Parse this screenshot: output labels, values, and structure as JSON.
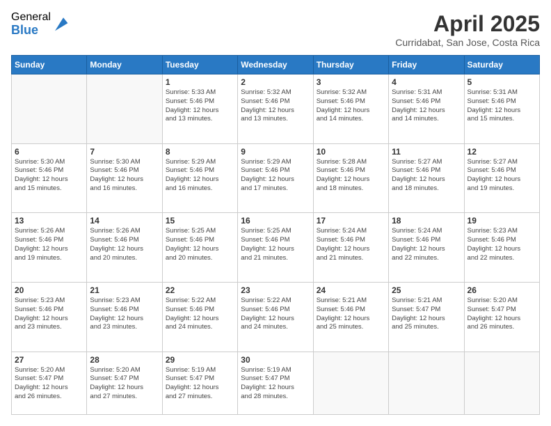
{
  "logo": {
    "general": "General",
    "blue": "Blue"
  },
  "header": {
    "title": "April 2025",
    "subtitle": "Curridabat, San Jose, Costa Rica"
  },
  "weekdays": [
    "Sunday",
    "Monday",
    "Tuesday",
    "Wednesday",
    "Thursday",
    "Friday",
    "Saturday"
  ],
  "weeks": [
    [
      {
        "day": "",
        "detail": ""
      },
      {
        "day": "",
        "detail": ""
      },
      {
        "day": "1",
        "detail": "Sunrise: 5:33 AM\nSunset: 5:46 PM\nDaylight: 12 hours\nand 13 minutes."
      },
      {
        "day": "2",
        "detail": "Sunrise: 5:32 AM\nSunset: 5:46 PM\nDaylight: 12 hours\nand 13 minutes."
      },
      {
        "day": "3",
        "detail": "Sunrise: 5:32 AM\nSunset: 5:46 PM\nDaylight: 12 hours\nand 14 minutes."
      },
      {
        "day": "4",
        "detail": "Sunrise: 5:31 AM\nSunset: 5:46 PM\nDaylight: 12 hours\nand 14 minutes."
      },
      {
        "day": "5",
        "detail": "Sunrise: 5:31 AM\nSunset: 5:46 PM\nDaylight: 12 hours\nand 15 minutes."
      }
    ],
    [
      {
        "day": "6",
        "detail": "Sunrise: 5:30 AM\nSunset: 5:46 PM\nDaylight: 12 hours\nand 15 minutes."
      },
      {
        "day": "7",
        "detail": "Sunrise: 5:30 AM\nSunset: 5:46 PM\nDaylight: 12 hours\nand 16 minutes."
      },
      {
        "day": "8",
        "detail": "Sunrise: 5:29 AM\nSunset: 5:46 PM\nDaylight: 12 hours\nand 16 minutes."
      },
      {
        "day": "9",
        "detail": "Sunrise: 5:29 AM\nSunset: 5:46 PM\nDaylight: 12 hours\nand 17 minutes."
      },
      {
        "day": "10",
        "detail": "Sunrise: 5:28 AM\nSunset: 5:46 PM\nDaylight: 12 hours\nand 18 minutes."
      },
      {
        "day": "11",
        "detail": "Sunrise: 5:27 AM\nSunset: 5:46 PM\nDaylight: 12 hours\nand 18 minutes."
      },
      {
        "day": "12",
        "detail": "Sunrise: 5:27 AM\nSunset: 5:46 PM\nDaylight: 12 hours\nand 19 minutes."
      }
    ],
    [
      {
        "day": "13",
        "detail": "Sunrise: 5:26 AM\nSunset: 5:46 PM\nDaylight: 12 hours\nand 19 minutes."
      },
      {
        "day": "14",
        "detail": "Sunrise: 5:26 AM\nSunset: 5:46 PM\nDaylight: 12 hours\nand 20 minutes."
      },
      {
        "day": "15",
        "detail": "Sunrise: 5:25 AM\nSunset: 5:46 PM\nDaylight: 12 hours\nand 20 minutes."
      },
      {
        "day": "16",
        "detail": "Sunrise: 5:25 AM\nSunset: 5:46 PM\nDaylight: 12 hours\nand 21 minutes."
      },
      {
        "day": "17",
        "detail": "Sunrise: 5:24 AM\nSunset: 5:46 PM\nDaylight: 12 hours\nand 21 minutes."
      },
      {
        "day": "18",
        "detail": "Sunrise: 5:24 AM\nSunset: 5:46 PM\nDaylight: 12 hours\nand 22 minutes."
      },
      {
        "day": "19",
        "detail": "Sunrise: 5:23 AM\nSunset: 5:46 PM\nDaylight: 12 hours\nand 22 minutes."
      }
    ],
    [
      {
        "day": "20",
        "detail": "Sunrise: 5:23 AM\nSunset: 5:46 PM\nDaylight: 12 hours\nand 23 minutes."
      },
      {
        "day": "21",
        "detail": "Sunrise: 5:23 AM\nSunset: 5:46 PM\nDaylight: 12 hours\nand 23 minutes."
      },
      {
        "day": "22",
        "detail": "Sunrise: 5:22 AM\nSunset: 5:46 PM\nDaylight: 12 hours\nand 24 minutes."
      },
      {
        "day": "23",
        "detail": "Sunrise: 5:22 AM\nSunset: 5:46 PM\nDaylight: 12 hours\nand 24 minutes."
      },
      {
        "day": "24",
        "detail": "Sunrise: 5:21 AM\nSunset: 5:46 PM\nDaylight: 12 hours\nand 25 minutes."
      },
      {
        "day": "25",
        "detail": "Sunrise: 5:21 AM\nSunset: 5:47 PM\nDaylight: 12 hours\nand 25 minutes."
      },
      {
        "day": "26",
        "detail": "Sunrise: 5:20 AM\nSunset: 5:47 PM\nDaylight: 12 hours\nand 26 minutes."
      }
    ],
    [
      {
        "day": "27",
        "detail": "Sunrise: 5:20 AM\nSunset: 5:47 PM\nDaylight: 12 hours\nand 26 minutes."
      },
      {
        "day": "28",
        "detail": "Sunrise: 5:20 AM\nSunset: 5:47 PM\nDaylight: 12 hours\nand 27 minutes."
      },
      {
        "day": "29",
        "detail": "Sunrise: 5:19 AM\nSunset: 5:47 PM\nDaylight: 12 hours\nand 27 minutes."
      },
      {
        "day": "30",
        "detail": "Sunrise: 5:19 AM\nSunset: 5:47 PM\nDaylight: 12 hours\nand 28 minutes."
      },
      {
        "day": "",
        "detail": ""
      },
      {
        "day": "",
        "detail": ""
      },
      {
        "day": "",
        "detail": ""
      }
    ]
  ]
}
